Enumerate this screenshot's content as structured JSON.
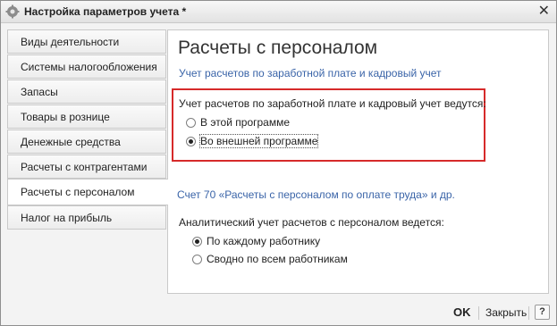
{
  "window": {
    "title": "Настройка параметров учета *",
    "icon": "gear-icon",
    "close_icon": "close-icon"
  },
  "sidebar": {
    "items": [
      {
        "label": "Виды деятельности"
      },
      {
        "label": "Системы налогообложения"
      },
      {
        "label": "Запасы"
      },
      {
        "label": "Товары в рознице"
      },
      {
        "label": "Денежные средства"
      },
      {
        "label": "Расчеты с контрагентами"
      },
      {
        "label": "Расчеты с персоналом",
        "active": true
      },
      {
        "label": "Налог на прибыль"
      }
    ]
  },
  "content": {
    "heading": "Расчеты с персоналом",
    "payroll_link": "Учет расчетов по заработной плате и кадровый учет",
    "payroll_question": "Учет расчетов по заработной плате и кадровый учет ведутся:",
    "payroll_options": [
      {
        "label": "В этой программе",
        "selected": false
      },
      {
        "label": "Во внешней программе",
        "selected": true
      }
    ],
    "account_link": "Счет 70 «Расчеты с персоналом по оплате труда» и др.",
    "analytics_question": "Аналитический учет расчетов с персоналом ведется:",
    "analytics_options": [
      {
        "label": "По каждому работнику",
        "selected": true
      },
      {
        "label": "Сводно по всем работникам",
        "selected": false
      }
    ],
    "highlight_color": "#d62a2a",
    "link_color": "#3a64a8"
  },
  "footer": {
    "ok_label": "OK",
    "close_label": "Закрыть",
    "help_label": "?"
  }
}
